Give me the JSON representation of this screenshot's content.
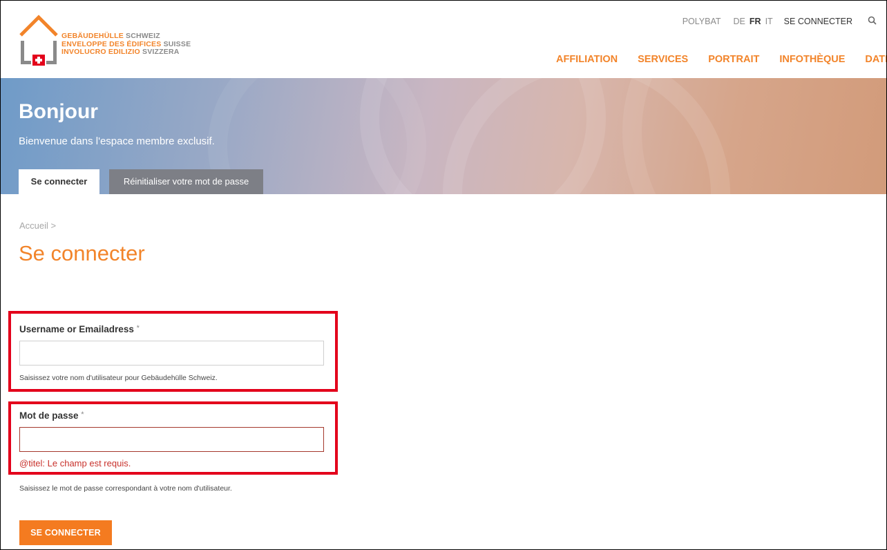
{
  "logo": {
    "line1_bold": "GEBÄUDEHÜLLE",
    "line1_light": "SCHWEIZ",
    "line2_bold": "ENVELOPPE DES ÉDIFICES",
    "line2_light": "SUISSE",
    "line3_bold": "INVOLUCRO EDILIZIO",
    "line3_light": "SVIZZERA"
  },
  "topbar": {
    "polybat": "POLYBAT",
    "languages": [
      "DE",
      "FR",
      "IT"
    ],
    "active_language": "FR",
    "login": "SE CONNECTER",
    "search_icon": "search-icon"
  },
  "main_nav": [
    "AFFILIATION",
    "SERVICES",
    "PORTRAIT",
    "INFOTHÈQUE",
    "DATES"
  ],
  "banner": {
    "title": "Bonjour",
    "subtitle": "Bienvenue dans l'espace membre exclusif.",
    "tabs": [
      {
        "label": "Se connecter",
        "active": true
      },
      {
        "label": "Réinitialiser votre mot de passe",
        "active": false
      }
    ]
  },
  "breadcrumb": "Accueil >",
  "page_title": "Se connecter",
  "form": {
    "username": {
      "label": "Username or Emailadress",
      "required_mark": "*",
      "value": "",
      "help": "Saisissez votre nom d'utilisateur pour Gebäudehülle Schweiz."
    },
    "password": {
      "label": "Mot de passe",
      "required_mark": "*",
      "value": "",
      "error": "@titel: Le champ est requis.",
      "help": "Saisissez le mot de passe correspondant à votre nom d'utilisateur."
    },
    "submit_label": "SE CONNECTER"
  },
  "colors": {
    "accent": "#f2842a",
    "button": "#f47b20",
    "error": "#c8312b",
    "highlight_box": "#e3001b",
    "inactive_tab": "#7d7f86"
  }
}
